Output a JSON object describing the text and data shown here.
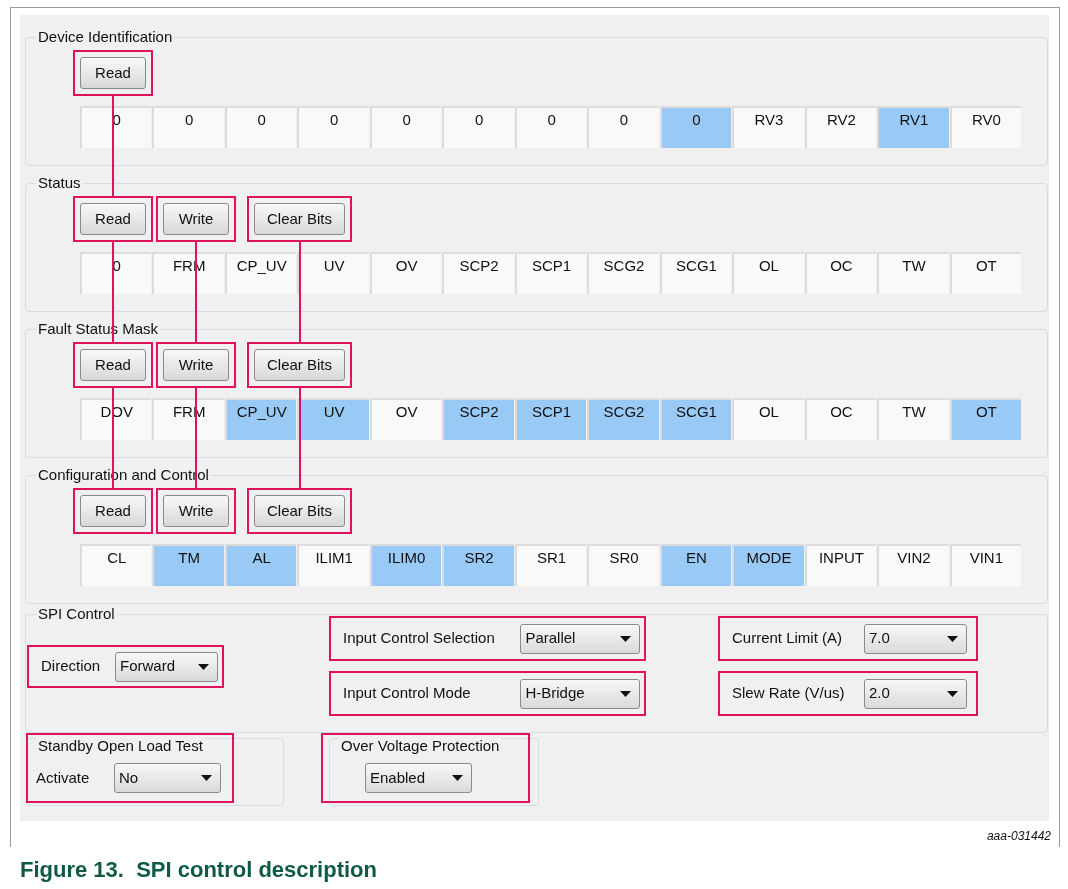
{
  "sections": [
    {
      "title": "Device Identification",
      "buttons": [
        "Read"
      ],
      "bits": [
        {
          "text": "0",
          "set": false
        },
        {
          "text": "0",
          "set": false
        },
        {
          "text": "0",
          "set": false
        },
        {
          "text": "0",
          "set": false
        },
        {
          "text": "0",
          "set": false
        },
        {
          "text": "0",
          "set": false
        },
        {
          "text": "0",
          "set": false
        },
        {
          "text": "0",
          "set": false
        },
        {
          "text": "0",
          "set": true
        },
        {
          "text": "RV3",
          "set": false
        },
        {
          "text": "RV2",
          "set": false
        },
        {
          "text": "RV1",
          "set": true
        },
        {
          "text": "RV0",
          "set": false
        }
      ]
    },
    {
      "title": "Status",
      "buttons": [
        "Read",
        "Write",
        "Clear Bits"
      ],
      "bits": [
        {
          "text": "0",
          "set": false
        },
        {
          "text": "FRM",
          "set": false
        },
        {
          "text": "CP_UV",
          "set": false
        },
        {
          "text": "UV",
          "set": false
        },
        {
          "text": "OV",
          "set": false
        },
        {
          "text": "SCP2",
          "set": false
        },
        {
          "text": "SCP1",
          "set": false
        },
        {
          "text": "SCG2",
          "set": false
        },
        {
          "text": "SCG1",
          "set": false
        },
        {
          "text": "OL",
          "set": false
        },
        {
          "text": "OC",
          "set": false
        },
        {
          "text": "TW",
          "set": false
        },
        {
          "text": "OT",
          "set": false
        }
      ]
    },
    {
      "title": "Fault Status Mask",
      "buttons": [
        "Read",
        "Write",
        "Clear Bits"
      ],
      "bits": [
        {
          "text": "DOV",
          "set": false
        },
        {
          "text": "FRM",
          "set": false
        },
        {
          "text": "CP_UV",
          "set": true
        },
        {
          "text": "UV",
          "set": true
        },
        {
          "text": "OV",
          "set": false
        },
        {
          "text": "SCP2",
          "set": true
        },
        {
          "text": "SCP1",
          "set": true
        },
        {
          "text": "SCG2",
          "set": true
        },
        {
          "text": "SCG1",
          "set": true
        },
        {
          "text": "OL",
          "set": false
        },
        {
          "text": "OC",
          "set": false
        },
        {
          "text": "TW",
          "set": false
        },
        {
          "text": "OT",
          "set": true
        }
      ]
    },
    {
      "title": "Configuration and Control",
      "buttons": [
        "Read",
        "Write",
        "Clear Bits"
      ],
      "bits": [
        {
          "text": "CL",
          "set": false
        },
        {
          "text": "TM",
          "set": true
        },
        {
          "text": "AL",
          "set": true
        },
        {
          "text": "ILIM1",
          "set": false
        },
        {
          "text": "ILIM0",
          "set": true
        },
        {
          "text": "SR2",
          "set": true
        },
        {
          "text": "SR1",
          "set": false
        },
        {
          "text": "SR0",
          "set": false
        },
        {
          "text": "EN",
          "set": true
        },
        {
          "text": "MODE",
          "set": true
        },
        {
          "text": "INPUT",
          "set": false
        },
        {
          "text": "VIN2",
          "set": false
        },
        {
          "text": "VIN1",
          "set": false
        }
      ]
    }
  ],
  "spi_control": {
    "title": "SPI Control",
    "direction": {
      "label": "Direction",
      "value": "Forward"
    },
    "input_control_selection": {
      "label": "Input Control Selection",
      "value": "Parallel"
    },
    "input_control_mode": {
      "label": "Input Control Mode",
      "value": "H-Bridge"
    },
    "current_limit": {
      "label": "Current Limit (A)",
      "value": "7.0"
    },
    "slew_rate": {
      "label": "Slew Rate (V/us)",
      "value": "2.0"
    }
  },
  "standby_open_load_test": {
    "title": "Standby Open Load Test",
    "label": "Activate",
    "value": "No"
  },
  "over_voltage_protection": {
    "title": "Over Voltage Protection",
    "value": "Enabled"
  },
  "figure_id": "aaa-031442",
  "caption": "Figure 13.  SPI control description"
}
